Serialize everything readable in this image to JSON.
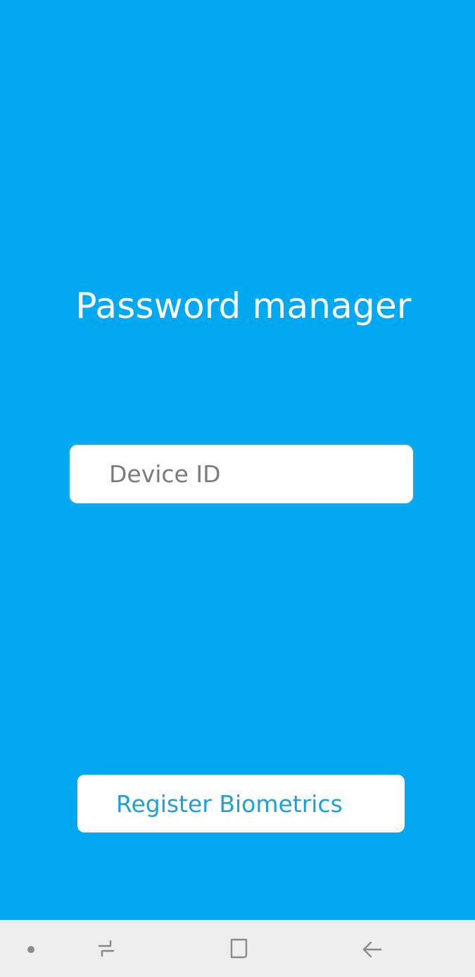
{
  "app": {
    "title": "Password manager"
  },
  "device_field": {
    "placeholder": "Device ID",
    "value": ""
  },
  "register_button": {
    "label": "Register Biometrics"
  },
  "nav_bar": {
    "items": [
      {
        "icon": "dot-icon"
      },
      {
        "icon": "recents-icon"
      },
      {
        "icon": "home-icon"
      },
      {
        "icon": "back-icon"
      }
    ]
  },
  "colors": {
    "background": "#03A9F0",
    "field_border": "#1DA6E6",
    "button_text": "#1E9FDB",
    "nav_background": "#EEEEEE",
    "nav_icon": "#8A8A8A"
  }
}
